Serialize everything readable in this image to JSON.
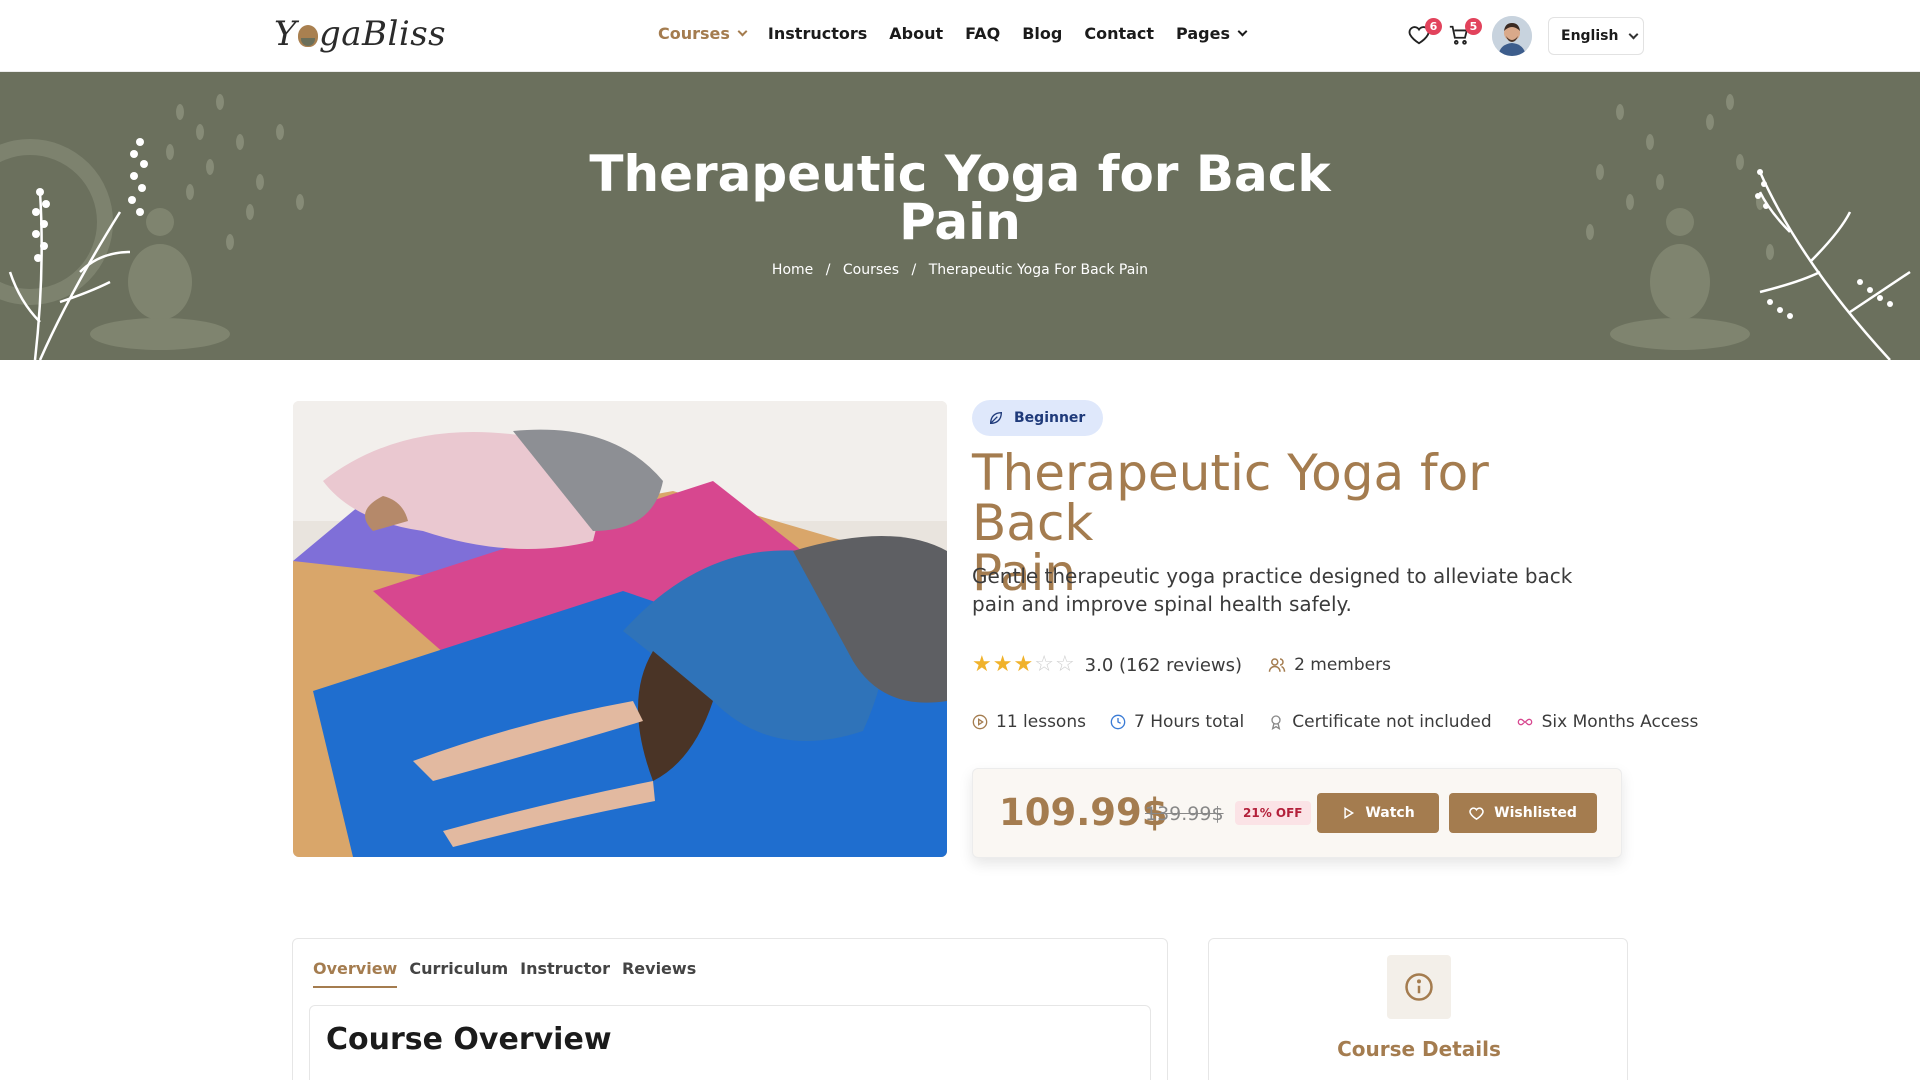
{
  "header": {
    "logo_part1": "Y",
    "logo_part2": "gaBliss",
    "nav": [
      "Courses",
      "Instructors",
      "About",
      "FAQ",
      "Blog",
      "Contact",
      "Pages"
    ],
    "wishlist_count": "6",
    "cart_count": "5",
    "language": "English"
  },
  "hero": {
    "title_line1": "Therapeutic Yoga for Back",
    "title_line2": "Pain",
    "breadcrumb": [
      "Home",
      "Courses",
      "Therapeutic Yoga For Back Pain"
    ],
    "breadcrumb_sep": "/"
  },
  "course": {
    "level": "Beginner",
    "title_line1": "Therapeutic Yoga for Back",
    "title_line2": "Pain",
    "description": "Gentle therapeutic yoga practice designed to alleviate back pain and improve spinal health safely.",
    "rating": 3,
    "rating_text": "3.0 (162 reviews)",
    "members": "2 members",
    "lessons": "11 lessons",
    "hours": "7 Hours total",
    "certificate": "Certificate not included",
    "access": "Six Months Access",
    "price": "109.99$",
    "old_price": "139.99$",
    "discount": "21% OFF",
    "watch_label": "Watch",
    "wishlist_label": "Wishlisted"
  },
  "tabs": {
    "items": [
      "Overview",
      "Curriculum",
      "Instructor",
      "Reviews"
    ],
    "active": "Overview",
    "overview_title": "Course Overview"
  },
  "details": {
    "title": "Course Details"
  },
  "colors": {
    "accent": "#a47c4f",
    "hero_bg": "#6b705d",
    "badge": "#e2435c"
  }
}
